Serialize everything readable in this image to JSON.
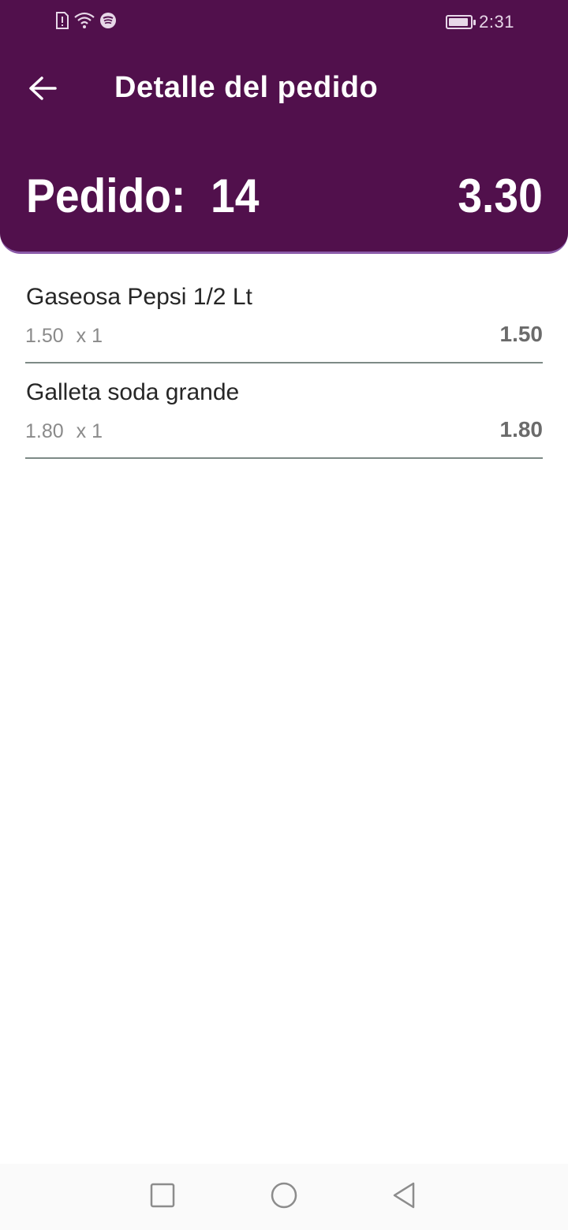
{
  "status_bar": {
    "time": "2:31",
    "icons_left": [
      "sim-alert-icon",
      "wifi-icon",
      "spotify-icon"
    ],
    "icons_right": [
      "battery-icon"
    ]
  },
  "toolbar": {
    "back_icon": "arrow-left-icon",
    "title": "Detalle del pedido"
  },
  "order": {
    "label": "Pedido:",
    "number": "14",
    "total": "3.30"
  },
  "items": [
    {
      "name": "Gaseosa Pepsi 1/2 Lt",
      "unit_price": "1.50",
      "quantity": "x 1",
      "subtotal": "1.50"
    },
    {
      "name": "Galleta soda grande",
      "unit_price": "1.80",
      "quantity": "x 1",
      "subtotal": "1.80"
    }
  ],
  "nav_bar": {
    "buttons": [
      "square-icon",
      "circle-icon",
      "triangle-back-icon"
    ]
  },
  "colors": {
    "header_bg": "#51104c",
    "header_border": "#8a5aa8",
    "divider": "#7d8a86"
  }
}
